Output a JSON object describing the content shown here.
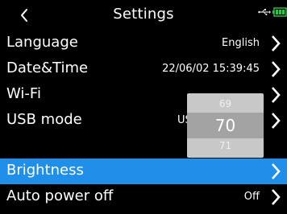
{
  "header": {
    "title": "Settings"
  },
  "icons": {
    "back": "chevron-left-icon",
    "usb": "usb-icon",
    "battery": "battery-icon",
    "row_arrow": "chevron-right-icon"
  },
  "colors": {
    "background": "#000000",
    "selected_row": "#1f8fea",
    "picker_bg": "#c8c8c8",
    "picker_band": "#a3a3a3"
  },
  "rows": [
    {
      "label": "Language",
      "value": "English"
    },
    {
      "label": "Date&Time",
      "value": "22/06/02 15:39:45"
    },
    {
      "label": "Wi-Fi",
      "value": ""
    },
    {
      "label": "USB mode",
      "value": "USE"
    },
    {
      "label": "Brightness",
      "value": "",
      "selected": true
    },
    {
      "label": "Auto power off",
      "value": "Off"
    }
  ],
  "picker": {
    "previous": "69",
    "current": "70",
    "next": "71"
  }
}
